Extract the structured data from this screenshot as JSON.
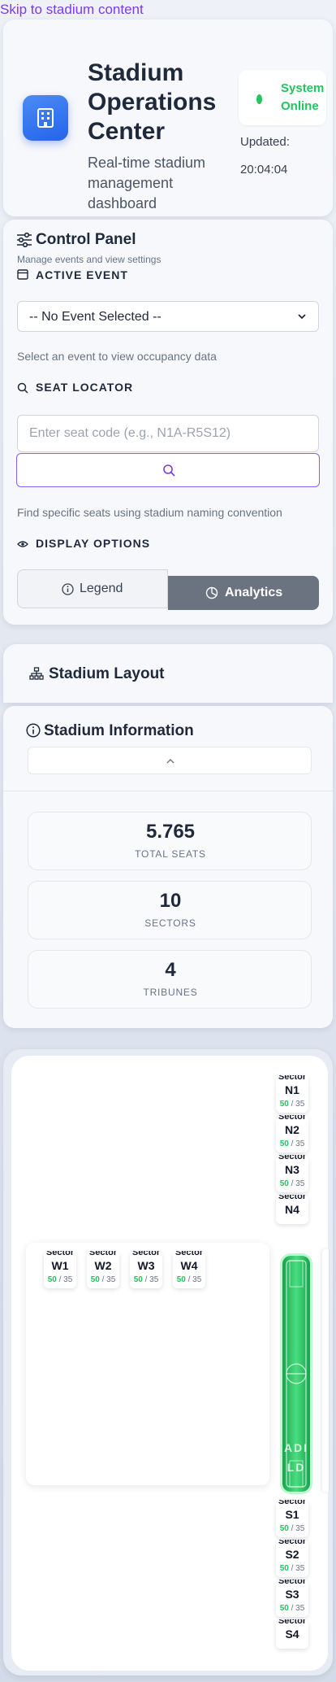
{
  "skip_link": "Skip to stadium content",
  "header": {
    "title": "Stadium Operations Center",
    "subtitle": "Real-time stadium management dashboard",
    "status": "System Online",
    "updated_label": "Updated:",
    "updated_time": "20:04:04",
    "logo_icon": "building-icon",
    "colors": {
      "accent": "#2563eb",
      "online": "#22c55e"
    }
  },
  "control_panel": {
    "title": "Control Panel",
    "subtitle": "Manage events and view settings",
    "active_event": {
      "label": "ACTIVE EVENT",
      "selected": "-- No Event Selected --",
      "hint": "Select an event to view occupancy data"
    },
    "seat_locator": {
      "label": "SEAT LOCATOR",
      "placeholder": "Enter seat code (e.g., N1A-R5S12)",
      "hint": "Find specific seats using stadium naming convention"
    },
    "display_options": {
      "label": "DISPLAY OPTIONS",
      "legend": "Legend",
      "analytics": "Analytics"
    }
  },
  "layout": {
    "title": "Stadium Layout"
  },
  "info": {
    "title": "Stadium Information",
    "stats": [
      {
        "value": "5.765",
        "label": "TOTAL SEATS"
      },
      {
        "value": "10",
        "label": "SECTORS"
      },
      {
        "value": "4",
        "label": "TRIBUNES"
      }
    ]
  },
  "map": {
    "sector_word": "Sector",
    "field_text": [
      "ADI",
      "LD"
    ],
    "north": [
      {
        "code": "N1",
        "occupied": "50",
        "capacity": "35"
      },
      {
        "code": "N2",
        "occupied": "50",
        "capacity": "35"
      },
      {
        "code": "N3",
        "occupied": "50",
        "capacity": "35"
      },
      {
        "code": "N4"
      }
    ],
    "west": [
      {
        "code": "W1",
        "occupied": "50",
        "capacity": "35"
      },
      {
        "code": "W2",
        "occupied": "50",
        "capacity": "35"
      },
      {
        "code": "W3",
        "occupied": "50",
        "capacity": "35"
      },
      {
        "code": "W4",
        "occupied": "50",
        "capacity": "35"
      }
    ],
    "south": [
      {
        "code": "S1",
        "occupied": "50",
        "capacity": "35"
      },
      {
        "code": "S2",
        "occupied": "50",
        "capacity": "35"
      },
      {
        "code": "S3",
        "occupied": "50",
        "capacity": "35"
      },
      {
        "code": "S4"
      }
    ]
  }
}
